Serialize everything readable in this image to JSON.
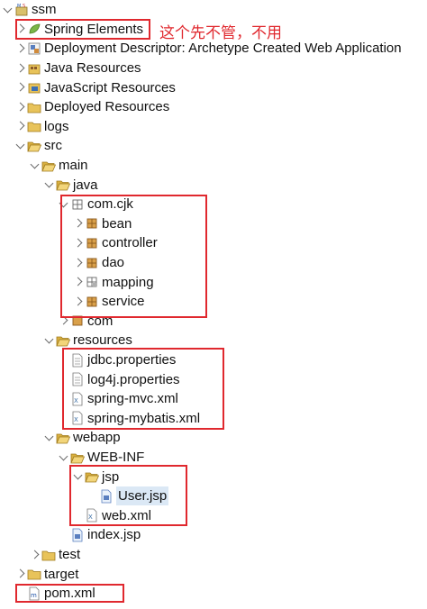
{
  "annotation_text": "这个先不管，不用",
  "tree": {
    "root": "ssm",
    "spring_elements": "Spring Elements",
    "deployment_descriptor": "Deployment Descriptor: Archetype Created Web Application",
    "java_resources": "Java Resources",
    "javascript_resources": "JavaScript Resources",
    "deployed_resources": "Deployed Resources",
    "logs": "logs",
    "src": "src",
    "main": "main",
    "java": "java",
    "com_cjk": "com.cjk",
    "bean": "bean",
    "controller": "controller",
    "dao": "dao",
    "mapping": "mapping",
    "service": "service",
    "com": "com",
    "resources": "resources",
    "jdbc_properties": "jdbc.properties",
    "log4j_properties": "log4j.properties",
    "spring_mvc_xml": "spring-mvc.xml",
    "spring_mybatis_xml": "spring-mybatis.xml",
    "webapp": "webapp",
    "web_inf": "WEB-INF",
    "jsp": "jsp",
    "user_jsp": "User.jsp",
    "web_xml": "web.xml",
    "index_jsp": "index.jsp",
    "test": "test",
    "target": "target",
    "pom_xml": "pom.xml"
  },
  "colors": {
    "annotation_red": "#e0282e",
    "folder_yellow": "#e8c35a",
    "selection": "#dbe8f5"
  }
}
